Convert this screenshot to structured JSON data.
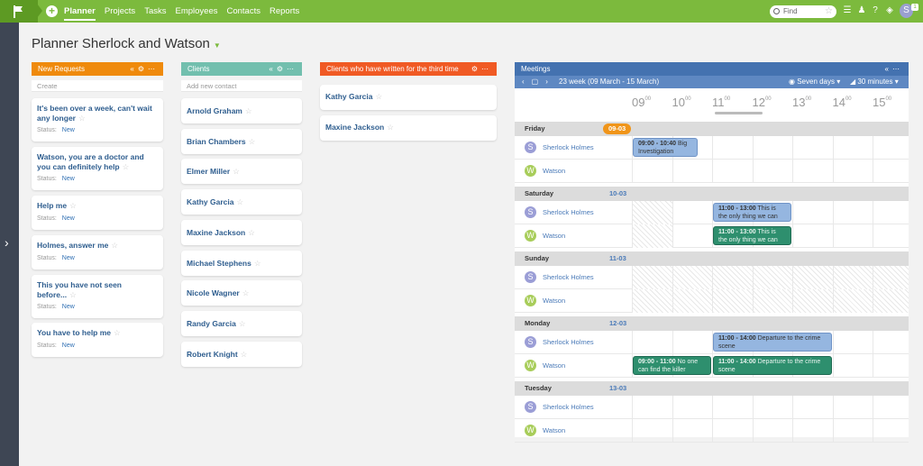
{
  "topbar": {
    "nav": [
      "Planner",
      "Projects",
      "Tasks",
      "Employees",
      "Contacts",
      "Reports"
    ],
    "active_nav": "Planner",
    "search_placeholder": "Find",
    "user_initial": "S",
    "notification_count": "1"
  },
  "page": {
    "title": "Planner Sherlock and Watson"
  },
  "columns": {
    "new_requests": {
      "title": "New Requests",
      "color": "#ef8a0c",
      "sub": "Create",
      "cards": [
        {
          "title": "It's been over a week, can't wait any longer",
          "status_label": "Status:",
          "status": "New"
        },
        {
          "title": "Watson, you are a doctor and you can definitely help",
          "status_label": "Status:",
          "status": "New"
        },
        {
          "title": "Help me",
          "status_label": "Status:",
          "status": "New"
        },
        {
          "title": "Holmes, answer me",
          "status_label": "Status:",
          "status": "New"
        },
        {
          "title": "This you have not seen before...",
          "status_label": "Status:",
          "status": "New"
        },
        {
          "title": "You have to help me",
          "status_label": "Status:",
          "status": "New"
        }
      ]
    },
    "clients": {
      "title": "Clients",
      "color": "#72bfae",
      "sub": "Add new contact",
      "cards": [
        "Arnold Graham",
        "Brian Chambers",
        "Elmer Miller",
        "Kathy Garcia",
        "Maxine Jackson",
        "Michael Stephens",
        "Nicole Wagner",
        "Randy Garcia",
        "Robert Knight"
      ]
    },
    "third_time": {
      "title": "Clients who have written for the third time",
      "color": "#f05a24",
      "cards": [
        "Kathy Garcia",
        "Maxine Jackson"
      ]
    }
  },
  "meetings": {
    "title": "Meetings",
    "color": "#4472b0",
    "week": "23 week  (09 March - 15 March)",
    "range": "Seven days",
    "step": "30 minutes",
    "hours": [
      "09",
      "10",
      "11",
      "12",
      "13",
      "14",
      "15"
    ],
    "hour_suffix": "00",
    "days": [
      {
        "name": "Friday",
        "date": "09-03",
        "today": true,
        "people": [
          {
            "initial": "S",
            "name": "Sherlock Holmes",
            "color": "#9b9ed6"
          },
          {
            "initial": "W",
            "name": "Watson",
            "color": "#a8cd5a"
          }
        ]
      },
      {
        "name": "Saturday",
        "date": "10-03",
        "today": false,
        "people": [
          {
            "initial": "S",
            "name": "Sherlock Holmes",
            "color": "#9b9ed6"
          },
          {
            "initial": "W",
            "name": "Watson",
            "color": "#a8cd5a"
          }
        ]
      },
      {
        "name": "Sunday",
        "date": "11-03",
        "today": false,
        "people": [
          {
            "initial": "S",
            "name": "Sherlock Holmes",
            "color": "#9b9ed6"
          },
          {
            "initial": "W",
            "name": "Watson",
            "color": "#a8cd5a"
          }
        ]
      },
      {
        "name": "Monday",
        "date": "12-03",
        "today": false,
        "people": [
          {
            "initial": "S",
            "name": "Sherlock Holmes",
            "color": "#9b9ed6"
          },
          {
            "initial": "W",
            "name": "Watson",
            "color": "#a8cd5a"
          }
        ]
      },
      {
        "name": "Tuesday",
        "date": "13-03",
        "today": false,
        "people": [
          {
            "initial": "S",
            "name": "Sherlock Holmes",
            "color": "#9b9ed6"
          },
          {
            "initial": "W",
            "name": "Watson",
            "color": "#a8cd5a"
          }
        ]
      }
    ],
    "events": [
      {
        "day": 0,
        "person": 0,
        "time": "09:00 - 10:40",
        "text": "Big Investigation",
        "color": "blue"
      },
      {
        "day": 1,
        "person": 0,
        "time": "11:00 - 13:00",
        "text": "This is the only thing we can do",
        "color": "blue"
      },
      {
        "day": 1,
        "person": 1,
        "time": "11:00 - 13:00",
        "text": "This is the only thing we can do",
        "color": "green"
      },
      {
        "day": 3,
        "person": 0,
        "time": "11:00 - 14:00",
        "text": "Departure to the crime scene",
        "color": "blue"
      },
      {
        "day": 3,
        "person": 1,
        "time": "09:00 - 11:00",
        "text": "No one can find the killer",
        "color": "green"
      },
      {
        "day": 3,
        "person": 1,
        "time": "11:00 - 14:00",
        "text": "Departure to the crime scene",
        "color": "green"
      }
    ]
  }
}
